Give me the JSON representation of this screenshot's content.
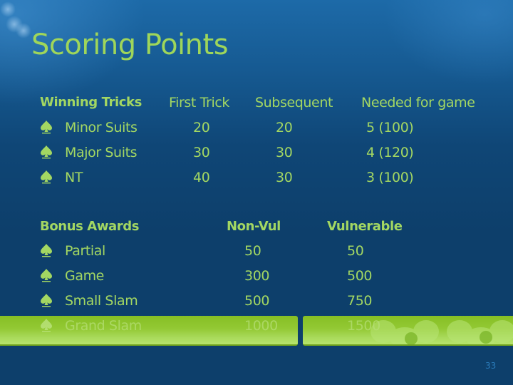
{
  "slide": {
    "title": "Scoring Points",
    "page_number": "33",
    "colors": {
      "text_accent": "#a3d762",
      "background": "#0d3f6b",
      "band": "#93c934"
    }
  },
  "winning_tricks": {
    "headers": [
      "Winning Tricks",
      "First Trick",
      "Subsequent",
      "Needed for game"
    ],
    "bullet_icon": "spade-icon",
    "rows": [
      {
        "label": "Minor Suits",
        "first_trick": "20",
        "subsequent": "20",
        "needed": "5 (100)"
      },
      {
        "label": "Major Suits",
        "first_trick": "30",
        "subsequent": "30",
        "needed": "4 (120)"
      },
      {
        "label": "NT",
        "first_trick": "40",
        "subsequent": "30",
        "needed": "3 (100)"
      }
    ]
  },
  "bonus_awards": {
    "headers": [
      "Bonus Awards",
      "Non-Vul",
      "Vulnerable"
    ],
    "bullet_icon": "spade-icon",
    "rows": [
      {
        "label": "Partial",
        "non_vul": "50",
        "vulnerable": "50"
      },
      {
        "label": "Game",
        "non_vul": "300",
        "vulnerable": "500"
      },
      {
        "label": "Small Slam",
        "non_vul": "500",
        "vulnerable": "750"
      },
      {
        "label": "Grand Slam",
        "non_vul": "1000",
        "vulnerable": "1500"
      }
    ]
  }
}
